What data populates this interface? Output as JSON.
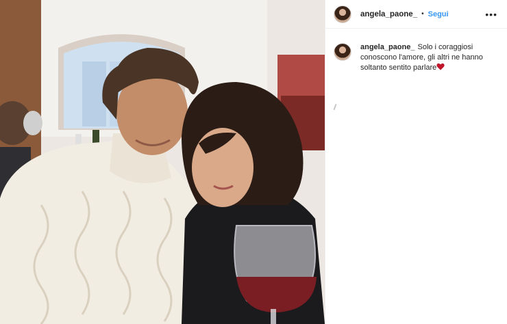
{
  "post": {
    "image_alt": "Couple photo with wine glass",
    "author": {
      "username": "angela_paone_",
      "follow_label": "Segui",
      "separator": "•",
      "more_label": "•••"
    },
    "caption": {
      "username": "angela_paone_",
      "text": "Solo i coraggiosi conoscono l'amore, gli altri ne hanno soltanto sentito parlare",
      "emoji_icon": "red-heart-icon"
    }
  },
  "colors": {
    "follow": "#3897f0",
    "heart": "#c0142a",
    "divider": "#efefef"
  }
}
